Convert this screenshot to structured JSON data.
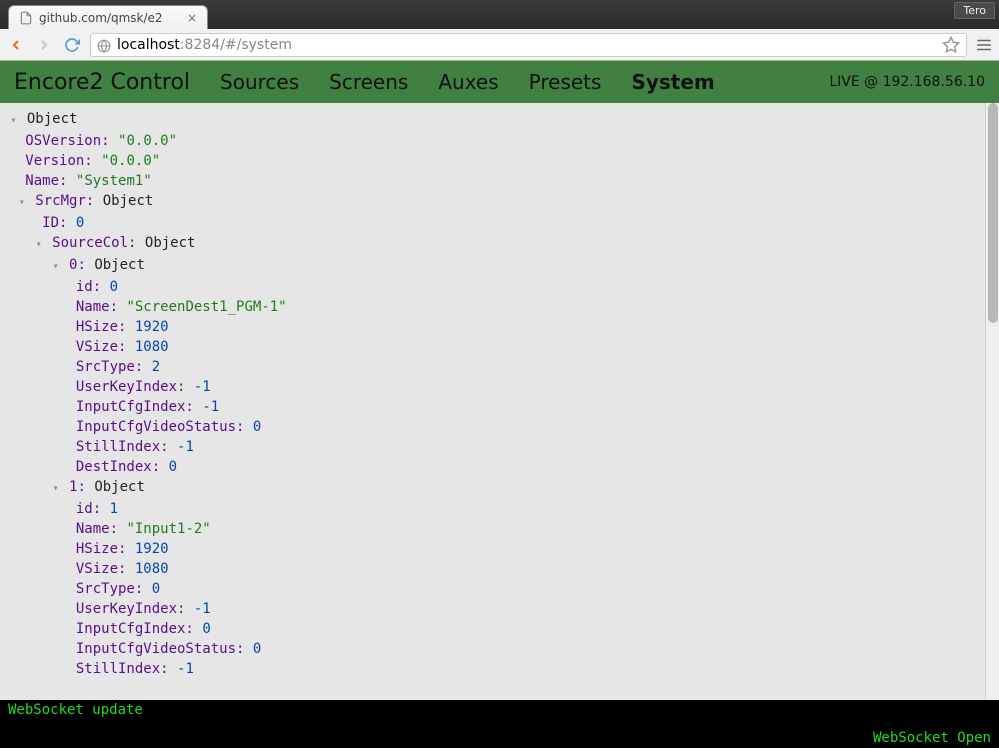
{
  "browser": {
    "tab_title": "github.com/qmsk/e2",
    "user_chip": "Tero",
    "url_host": "localhost",
    "url_rest": ":8284/#/system"
  },
  "header": {
    "app_title": "Encore2 Control",
    "nav": [
      "Sources",
      "Screens",
      "Auxes",
      "Presets",
      "System"
    ],
    "active_nav": "System",
    "live_status": "LIVE @ 192.168.56.10"
  },
  "tree": {
    "root_label": "Object",
    "OSVersion_key": "OSVersion:",
    "OSVersion_val": "\"0.0.0\"",
    "Version_key": "Version:",
    "Version_val": "\"0.0.0\"",
    "Name_key": "Name:",
    "Name_val": "\"System1\"",
    "SrcMgr_key": "SrcMgr:",
    "SrcMgr_type": "Object",
    "ID_key": "ID:",
    "ID_val": "0",
    "SourceCol_key": "SourceCol:",
    "SourceCol_type": "Object",
    "idx0_key": "0:",
    "idx0_type": "Object",
    "idx1_key": "1:",
    "idx1_type": "Object",
    "items0": {
      "id_key": "id:",
      "id_val": "0",
      "Name_key": "Name:",
      "Name_val": "\"ScreenDest1_PGM-1\"",
      "HSize_key": "HSize:",
      "HSize_val": "1920",
      "VSize_key": "VSize:",
      "VSize_val": "1080",
      "SrcType_key": "SrcType:",
      "SrcType_val": "2",
      "UserKeyIndex_key": "UserKeyIndex:",
      "UserKeyIndex_val": "-1",
      "InputCfgIndex_key": "InputCfgIndex:",
      "InputCfgIndex_val": "-1",
      "InputCfgVideoStatus_key": "InputCfgVideoStatus:",
      "InputCfgVideoStatus_val": "0",
      "StillIndex_key": "StillIndex:",
      "StillIndex_val": "-1",
      "DestIndex_key": "DestIndex:",
      "DestIndex_val": "0"
    },
    "items1": {
      "id_key": "id:",
      "id_val": "1",
      "Name_key": "Name:",
      "Name_val": "\"Input1-2\"",
      "HSize_key": "HSize:",
      "HSize_val": "1920",
      "VSize_key": "VSize:",
      "VSize_val": "1080",
      "SrcType_key": "SrcType:",
      "SrcType_val": "0",
      "UserKeyIndex_key": "UserKeyIndex:",
      "UserKeyIndex_val": "-1",
      "InputCfgIndex_key": "InputCfgIndex:",
      "InputCfgIndex_val": "0",
      "InputCfgVideoStatus_key": "InputCfgVideoStatus:",
      "InputCfgVideoStatus_val": "0",
      "StillIndex_key": "StillIndex:",
      "StillIndex_val": "-1"
    }
  },
  "footer": {
    "msg": "WebSocket update",
    "status": "WebSocket Open"
  }
}
